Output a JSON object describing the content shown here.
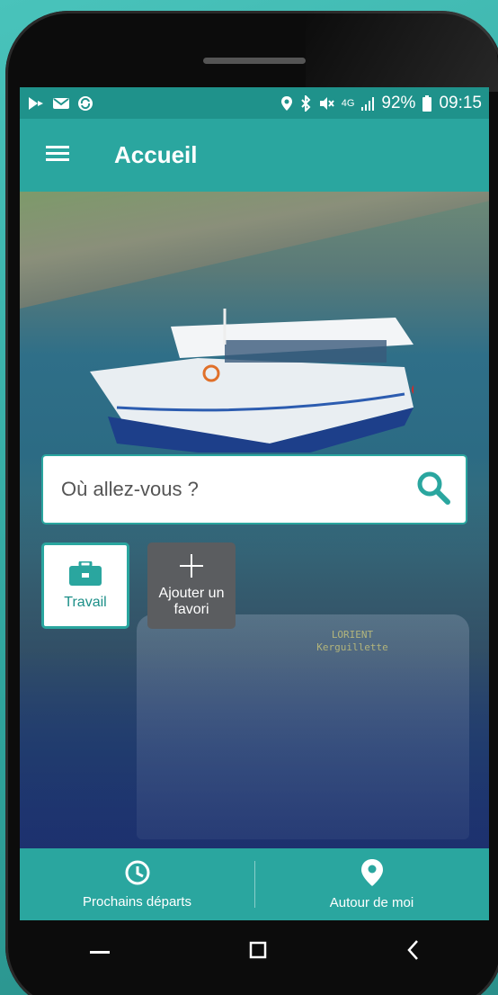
{
  "status_bar": {
    "left_icons": [
      "play-store-icon",
      "mail-icon",
      "sync-icon"
    ],
    "right_icons": [
      "location-icon",
      "bluetooth-icon",
      "mute-icon",
      "signal-icon",
      "battery-icon"
    ],
    "network": "4G",
    "battery": "92%",
    "time": "09:15"
  },
  "app_bar": {
    "title": "Accueil",
    "menu_icon": "hamburger-icon"
  },
  "search": {
    "placeholder": "Où allez-vous ?",
    "icon": "search-icon"
  },
  "favorites": [
    {
      "label": "Travail",
      "icon": "briefcase-icon"
    },
    {
      "label": "Ajouter un favori",
      "icon": "plus-icon"
    }
  ],
  "hero_bus_sign": [
    "LORIENT",
    "Kerguillette"
  ],
  "bottom_nav": [
    {
      "label": "Prochains départs",
      "icon": "clock-icon"
    },
    {
      "label": "Autour de moi",
      "icon": "location-pin-icon"
    }
  ],
  "system_keys": [
    "recent-apps-icon",
    "home-icon",
    "back-icon"
  ],
  "colors": {
    "primary": "#2aa69f",
    "status_bar": "#1f928b",
    "background": "#3fb8b1",
    "add_tile": "#5b5d60"
  }
}
